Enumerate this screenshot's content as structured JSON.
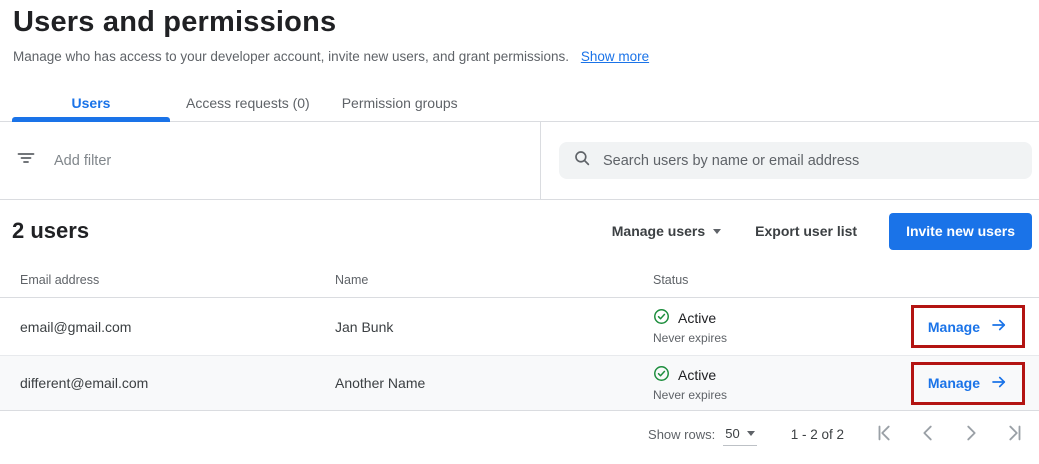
{
  "page": {
    "title": "Users and permissions",
    "subtitle": "Manage who has access to your developer account, invite new users, and grant permissions.",
    "show_more_label": "Show more"
  },
  "tabs": [
    {
      "label": "Users",
      "active": true
    },
    {
      "label": "Access requests (0)",
      "active": false
    },
    {
      "label": "Permission groups",
      "active": false
    }
  ],
  "filter": {
    "placeholder": "Add filter"
  },
  "search": {
    "placeholder": "Search users by name or email address"
  },
  "toolbar": {
    "count_label": "2 users",
    "manage_users_label": "Manage users",
    "export_label": "Export user list",
    "invite_label": "Invite new users"
  },
  "table": {
    "columns": {
      "email": "Email address",
      "name": "Name",
      "status": "Status"
    },
    "rows": [
      {
        "email": "email@gmail.com",
        "name": "Jan Bunk",
        "status": "Active",
        "expiry": "Never expires",
        "action": "Manage"
      },
      {
        "email": "different@email.com",
        "name": "Another Name",
        "status": "Active",
        "expiry": "Never expires",
        "action": "Manage"
      }
    ]
  },
  "pagination": {
    "show_rows_label": "Show rows:",
    "rows_per_page": "50",
    "range_label": "1 - 2 of 2"
  },
  "icons": {
    "filter": "filter-list-icon",
    "search": "search-icon",
    "status": "check-circle-icon",
    "manage_arrow": "arrow-right-icon",
    "dropdown": "caret-down-icon",
    "pager": [
      "first-page-icon",
      "chevron-left-icon",
      "chevron-right-icon",
      "last-page-icon"
    ]
  },
  "colors": {
    "accent_blue": "#1a73e8",
    "success_green": "#1e8e3e",
    "annotation_red": "#b31412",
    "text_primary": "#202124",
    "text_secondary": "#5f6368",
    "divider": "#dadce0",
    "alt_row_bg": "#f8f9fa",
    "search_bg": "#f1f3f4"
  }
}
